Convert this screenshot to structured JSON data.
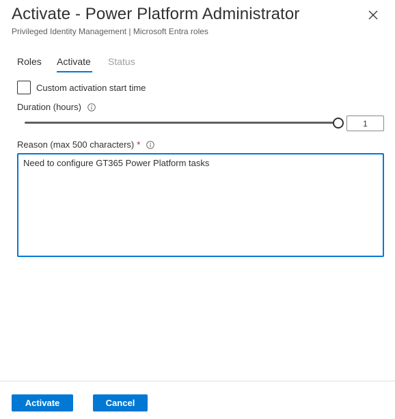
{
  "header": {
    "title": "Activate - Power Platform Administrator",
    "subtitle": "Privileged Identity Management | Microsoft Entra roles",
    "close_icon": "close-icon"
  },
  "tabs": [
    {
      "label": "Roles",
      "state": "normal"
    },
    {
      "label": "Activate",
      "state": "selected"
    },
    {
      "label": "Status",
      "state": "disabled"
    }
  ],
  "form": {
    "custom_start": {
      "label": "Custom activation start time",
      "checked": false
    },
    "duration": {
      "label": "Duration (hours)",
      "value": "1",
      "slider_fraction": 1.0,
      "info_icon": "info-icon"
    },
    "reason": {
      "label": "Reason (max 500 characters)",
      "required_mark": "*",
      "value": "Need to configure GT365 Power Platform tasks",
      "info_icon": "info-icon"
    }
  },
  "footer": {
    "activate_label": "Activate",
    "cancel_label": "Cancel"
  },
  "colors": {
    "accent": "#0078d4",
    "text": "#323130",
    "muted": "#605e5c",
    "disabled": "#a19f9d",
    "required": "#a4262c"
  }
}
